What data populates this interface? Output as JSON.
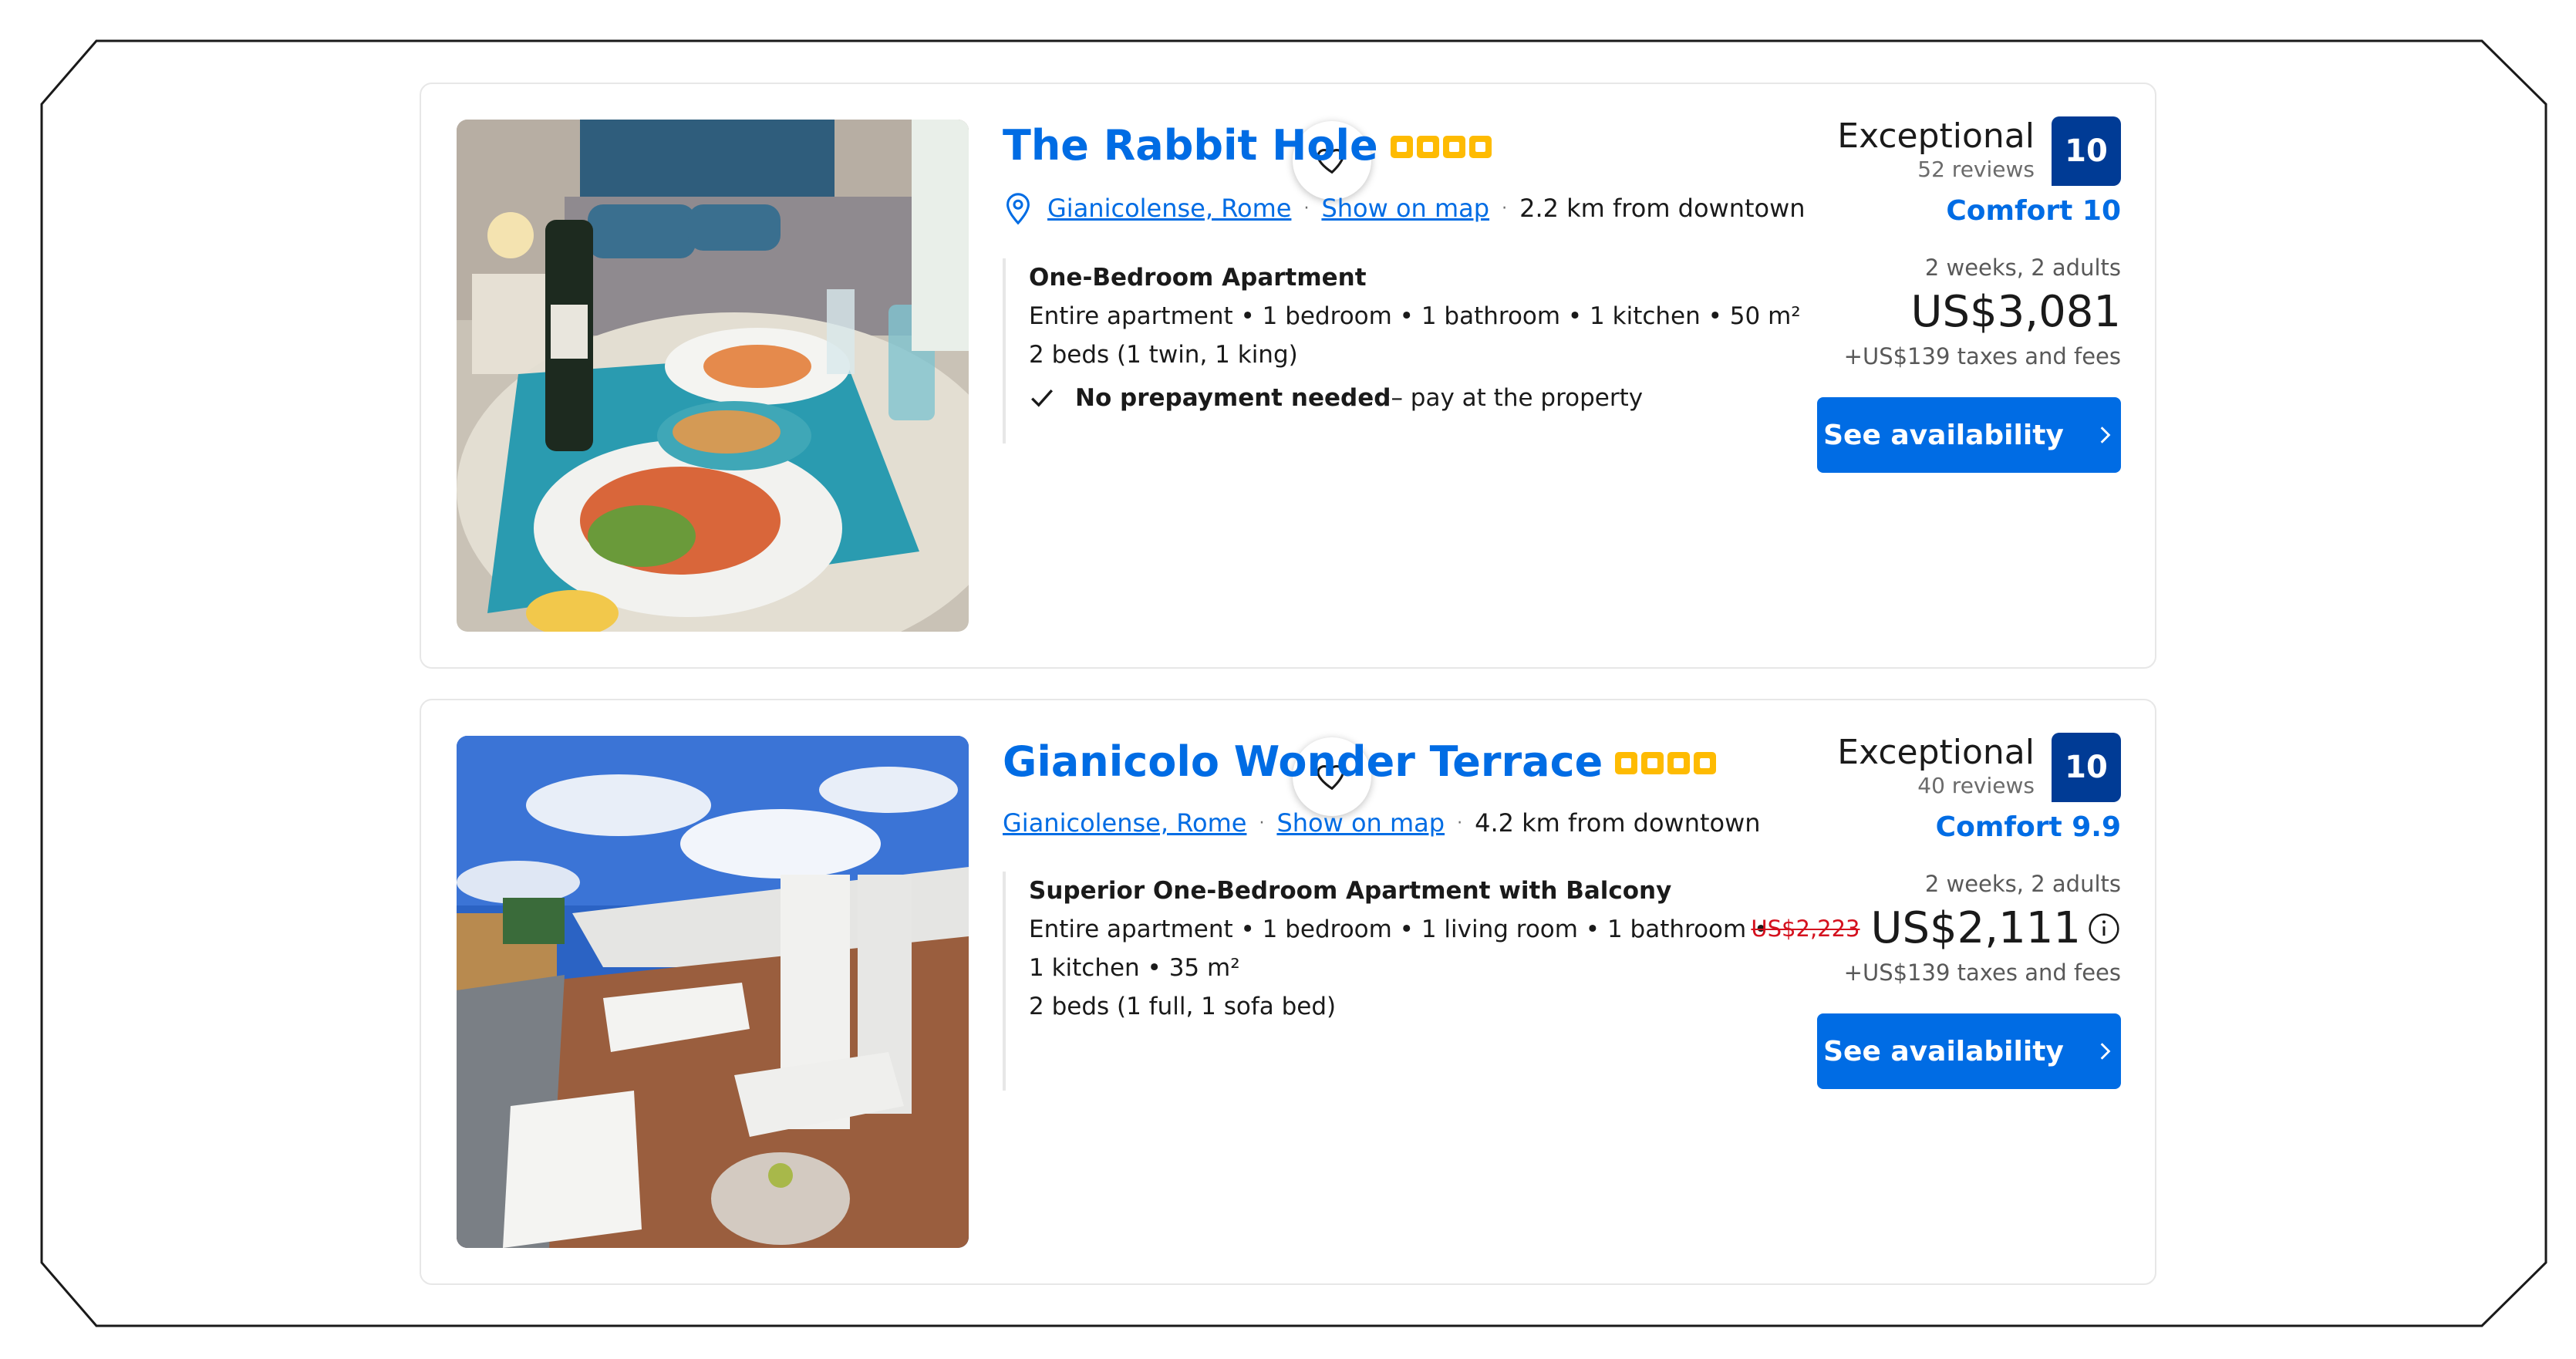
{
  "listings": [
    {
      "title": "The Rabbit Hole",
      "stars": 4,
      "location": "Gianicolense, Rome",
      "show_on_map": "Show on map",
      "distance": "2.2 km from downtown",
      "room_name": "One-Bedroom Apartment",
      "room_lines": [
        "Entire apartment • 1 bedroom • 1 bathroom • 1 kitchen • 50 m²",
        "2 beds (1 twin, 1 king)"
      ],
      "prepay_bold": "No prepayment needed",
      "prepay_rest": " – pay at the property",
      "score_word": "Exceptional",
      "reviews": "52 reviews",
      "score": "10",
      "comfort": "Comfort 10",
      "stay": "2 weeks, 2 adults",
      "old_price": "",
      "price": "US$3,081",
      "taxes": "+US$139 taxes and fees",
      "button": "See availability"
    },
    {
      "title": "Gianicolo Wonder Terrace",
      "stars": 4,
      "location": "Gianicolense, Rome",
      "show_on_map": "Show on map",
      "distance": "4.2 km from downtown",
      "room_name": "Superior One-Bedroom Apartment with Balcony",
      "room_lines": [
        "Entire apartment • 1 bedroom • 1 living room • 1 bathroom •",
        "1 kitchen • 35 m²",
        "2 beds (1 full, 1 sofa bed)"
      ],
      "score_word": "Exceptional",
      "reviews": "40 reviews",
      "score": "10",
      "comfort": "Comfort 9.9",
      "stay": "2 weeks, 2 adults",
      "old_price": "US$2,223",
      "price": "US$2,111",
      "taxes": "+US$139 taxes and fees",
      "button": "See availability"
    }
  ],
  "colors": {
    "accent": "#006ce4",
    "score_badge": "#003b95",
    "star": "#febb02",
    "strikethrough": "#d4111e"
  }
}
